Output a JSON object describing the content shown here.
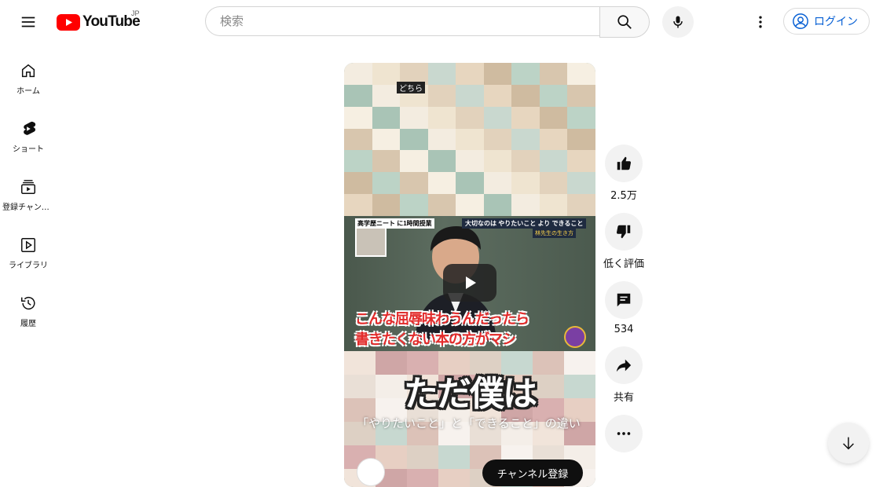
{
  "header": {
    "logo_text": "YouTube",
    "region": "JP",
    "search_placeholder": "検索",
    "login_label": "ログイン"
  },
  "sidebar": {
    "items": [
      {
        "label": "ホーム",
        "icon": "home-icon"
      },
      {
        "label": "ショート",
        "icon": "shorts-icon"
      },
      {
        "label": "登録チャンネル",
        "icon": "subscriptions-icon"
      },
      {
        "label": "ライブラリ",
        "icon": "library-icon"
      },
      {
        "label": "履歴",
        "icon": "history-icon"
      }
    ]
  },
  "video": {
    "top_tag": "どちら",
    "tv_label_left": "高学歴ニート に1時間授業",
    "tv_label_right": "大切なのは やりたいこと より できること",
    "tv_sub_right": "林先生の生き方",
    "caption_line1": "こんな屈辱味わうんだったら",
    "caption_line2": "書きたくない本の方がマシ",
    "big_caption": "ただ僕は",
    "title": "「やりたいこと」と「できること」の違い",
    "subscribe_label": "チャンネル登録"
  },
  "actions": {
    "like_count": "2.5万",
    "dislike_label": "低く評価",
    "comment_count": "534",
    "share_label": "共有"
  },
  "colors": {
    "brand_red": "#ff0000",
    "link_blue": "#065fd4",
    "button_bg": "#f2f2f2"
  }
}
